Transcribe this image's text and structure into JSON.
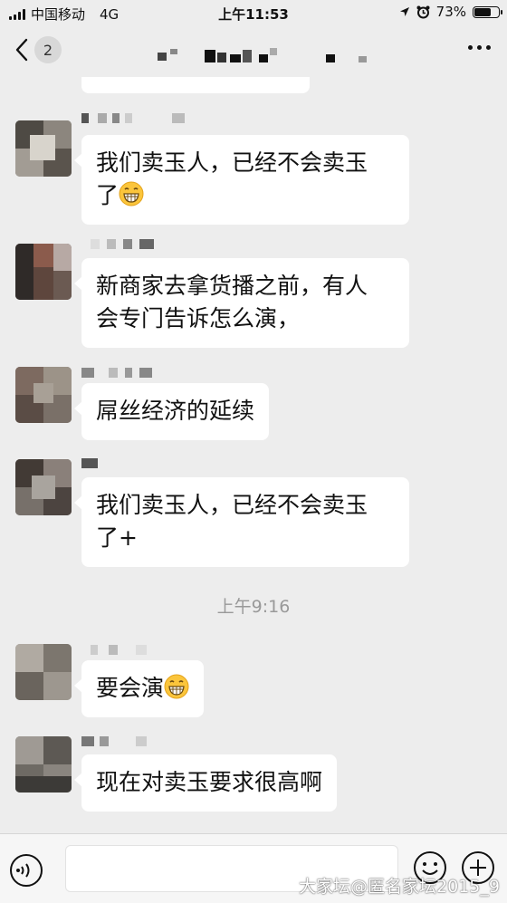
{
  "status_bar": {
    "carrier": "中国移动",
    "network": "4G",
    "time": "上午11:53",
    "battery_percent": "73%",
    "battery_level": 0.73
  },
  "nav": {
    "back_count": "2",
    "title_obscured": true
  },
  "messages": [
    {
      "type": "text",
      "text": "我们卖玉人，已经不会卖玉\n了",
      "emoji": "grin-emoji"
    },
    {
      "type": "text",
      "text": "新商家去拿货播之前，有人\n会专门告诉怎么演，",
      "emoji": null
    },
    {
      "type": "text",
      "text": "屌丝经济的延续",
      "emoji": null
    },
    {
      "type": "text",
      "text": "我们卖玉人，已经不会卖玉\n了+",
      "emoji": null
    },
    {
      "type": "text",
      "text": "要会演",
      "emoji": "grin-emoji"
    },
    {
      "type": "text",
      "text": "现在对卖玉要求很高啊",
      "emoji": null
    }
  ],
  "time_separator": "上午9:16",
  "input": {
    "placeholder": ""
  },
  "watermark": "大家坛@匿名家坛2015_9",
  "icons": [
    "chevron-left-icon",
    "more-icon",
    "voice-icon",
    "emoji-icon",
    "plus-icon",
    "location-icon",
    "alarm-icon",
    "battery-icon",
    "signal-icon"
  ]
}
